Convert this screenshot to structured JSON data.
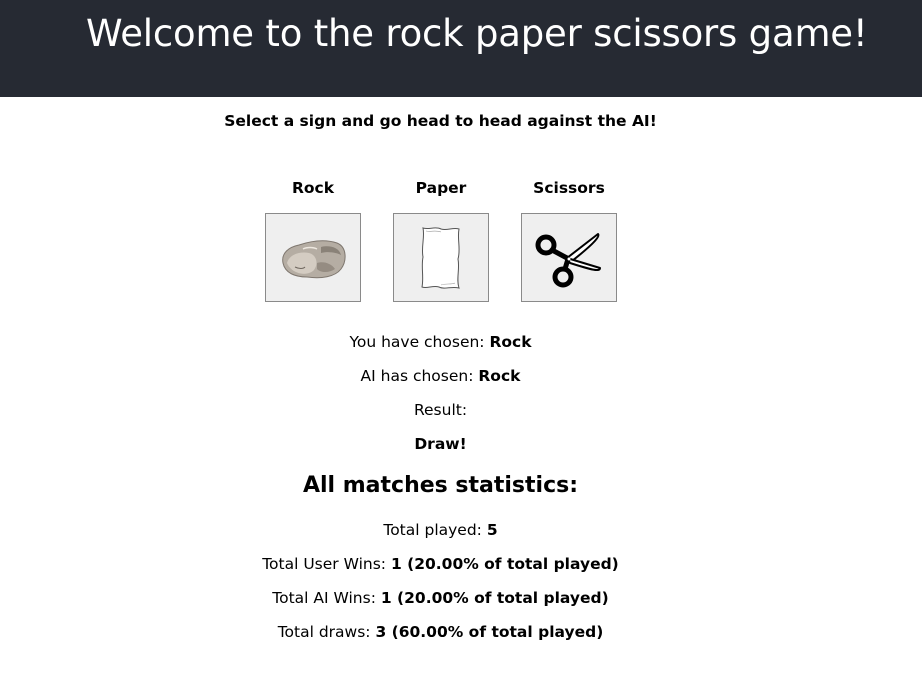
{
  "header": {
    "title": "Welcome to the rock paper scissors game!",
    "background": "#262a33"
  },
  "intro": {
    "text": "Select a sign and go head to head against the AI!"
  },
  "options": [
    {
      "label": "Rock",
      "icon": "rock-icon"
    },
    {
      "label": "Paper",
      "icon": "paper-icon"
    },
    {
      "label": "Scissors",
      "icon": "scissors-icon"
    }
  ],
  "round": {
    "user_label": "You have chosen: ",
    "user_value": "Rock",
    "ai_label": "AI has chosen: ",
    "ai_value": "Rock",
    "result_label": "Result:",
    "result_value": "Draw!"
  },
  "stats": {
    "title": "All matches statistics:",
    "total_label": "Total played: ",
    "total_value": "5",
    "user_wins_label": "Total User Wins: ",
    "user_wins_value": "1 (20.00% of total played)",
    "ai_wins_label": "Total AI Wins: ",
    "ai_wins_value": "1 (20.00% of total played)",
    "draws_label": "Total draws: ",
    "draws_value": "3 (60.00% of total played)"
  }
}
